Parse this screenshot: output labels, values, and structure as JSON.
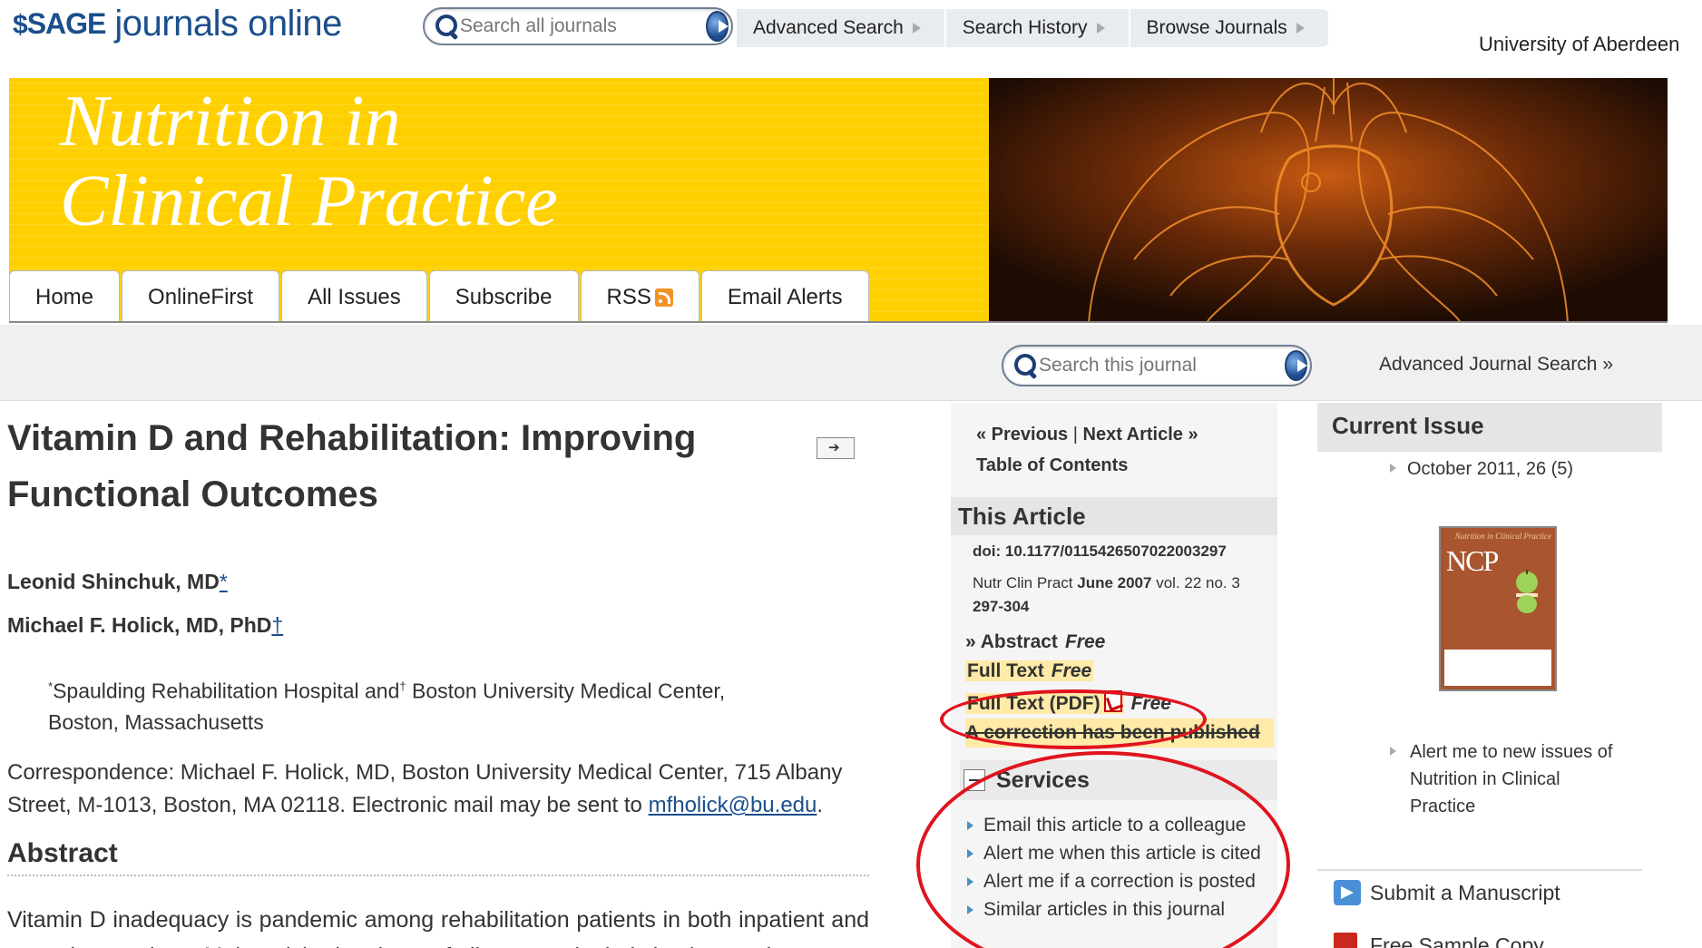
{
  "header": {
    "logo_sage": "SAGE",
    "logo_rest": "journals online",
    "search_all_placeholder": "Search all journals",
    "nav": [
      "Advanced Search",
      "Search History",
      "Browse Journals"
    ],
    "institution": "University of Aberdeen"
  },
  "banner": {
    "title_line1": "Nutrition in",
    "title_line2": "Clinical Practice",
    "tabs": [
      "Home",
      "OnlineFirst",
      "All Issues",
      "Subscribe",
      "RSS",
      "Email Alerts"
    ]
  },
  "journal_search": {
    "placeholder": "Search this journal",
    "advanced_link": "Advanced Journal Search »"
  },
  "article": {
    "title": "Vitamin D and Rehabilitation: Improving Functional Outcomes",
    "author1": "Leonid Shinchuk, MD",
    "author1_mark": "*",
    "author2": "Michael F. Holick, MD, PhD",
    "author2_mark": "†",
    "affil_mark1": "*",
    "affil_text1": "Spaulding Rehabilitation Hospital and",
    "affil_mark2": "†",
    "affil_text2": " Boston University Medical Center, Boston, Massachusetts",
    "correspondence": "Correspondence: Michael F. Holick, MD, Boston University Medical Center, 715 Albany Street, M-1013, Boston, MA 02118. Electronic mail may be sent to ",
    "email": "mfholick@bu.edu",
    "email_trail": ".",
    "abstract_heading": "Abstract",
    "abstract_text": "Vitamin D inadequacy is pandemic among rehabilitation patients in both inpatient and outpatient settings. Malnourished patients of all ages and ethnic backgrounds"
  },
  "sidebar": {
    "previous": "« Previous",
    "sep": "|",
    "next": "Next Article »",
    "toc": "Table of Contents",
    "this_article_heading": "This Article",
    "doi": "doi: 10.1177/0115426507022003297",
    "cite_prefix": "Nutr Clin Pract ",
    "cite_date": "June 2007",
    "cite_vol": " vol. 22 no. 3",
    "cite_pages": "297-304",
    "abstract_link": "» Abstract",
    "free": "Free",
    "full_text": "Full Text",
    "full_text_pdf": "Full Text (PDF)",
    "correction": "A correction has been published",
    "services_heading": "Services",
    "services": [
      "Email this article to a colleague",
      "Alert me when this article is cited",
      "Alert me if a correction is posted",
      "Similar articles in this journal"
    ]
  },
  "right": {
    "current_issue_heading": "Current Issue",
    "issue_link": "October 2011, 26 (5)",
    "cover_top": "Nutrition in Clinical Practice",
    "cover_ncp": "NCP",
    "alert_new": "Alert me to new issues of Nutrition in Clinical Practice",
    "submit": "Submit a Manuscript",
    "sample": "Free Sample Copy"
  },
  "colors": {
    "banner_yellow": "#ffd000",
    "sage_blue": "#1b4f8c",
    "annotation_red": "#e0141e",
    "highlight": "#ffeaa8"
  }
}
